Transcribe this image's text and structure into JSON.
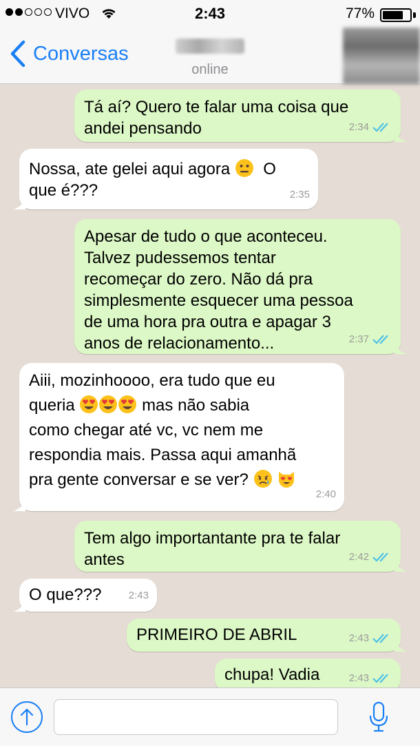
{
  "status_bar": {
    "carrier": "VIVO",
    "time": "2:43",
    "battery_percent": "77%",
    "battery_level": 0.77,
    "signal_bars_filled": 2,
    "signal_bars_total": 5
  },
  "nav": {
    "back_label": "Conversas",
    "contact_status": "online"
  },
  "messages": [
    {
      "direction": "out",
      "text": "Tá aí? Quero te falar uma coisa que\nandei pensando",
      "time": "2:34",
      "read": true
    },
    {
      "direction": "in",
      "text_parts": [
        "Nossa, ate gelei aqui agora ",
        "neutral-face-emoji",
        " O\nque é???"
      ],
      "text_a": "Nossa, ate gelei aqui agora",
      "text_b": "O",
      "text_c": "que é???",
      "time": "2:35"
    },
    {
      "direction": "out",
      "text": "Apesar de tudo o que aconteceu.\nTalvez pudessemos tentar\nrecomeçar do zero. Não dá pra\nsimplesmente esquecer uma pessoa\nde uma hora pra outra e apagar 3\nanos de relacionamento...",
      "time": "2:37",
      "read": true
    },
    {
      "direction": "in",
      "line1": "Aiii, mozinhoooo, era tudo que eu",
      "line2a": "queria",
      "line2b": "mas não sabia",
      "line3": "como chegar até vc, vc nem me",
      "line4": "respondia mais. Passa aqui amanhã",
      "line5": "pra gente conversar e se ver?",
      "time": "2:40"
    },
    {
      "direction": "out",
      "text": "Tem algo importantante pra te falar\nantes",
      "time": "2:42",
      "read": true
    },
    {
      "direction": "in",
      "text": "O que???",
      "time": "2:43"
    },
    {
      "direction": "out",
      "text": "PRIMEIRO DE ABRIL",
      "time": "2:43",
      "read": true
    },
    {
      "direction": "out",
      "text": "chupa! Vadia",
      "time": "2:43",
      "read": true
    }
  ],
  "input": {
    "placeholder": ""
  },
  "colors": {
    "accent": "#1a7ff5",
    "outgoing_bubble": "#dcf8c6",
    "incoming_bubble": "#ffffff",
    "chat_background": "#e5ddd5",
    "read_ticks": "#4fc1e9"
  },
  "icons": [
    "back-chevron-icon",
    "wifi-icon",
    "battery-icon",
    "upload-icon",
    "microphone-icon",
    "double-check-icon",
    "neutral-face-emoji",
    "heart-eyes-emoji",
    "sad-relieved-face-emoji",
    "heart-eyes-cat-emoji"
  ]
}
